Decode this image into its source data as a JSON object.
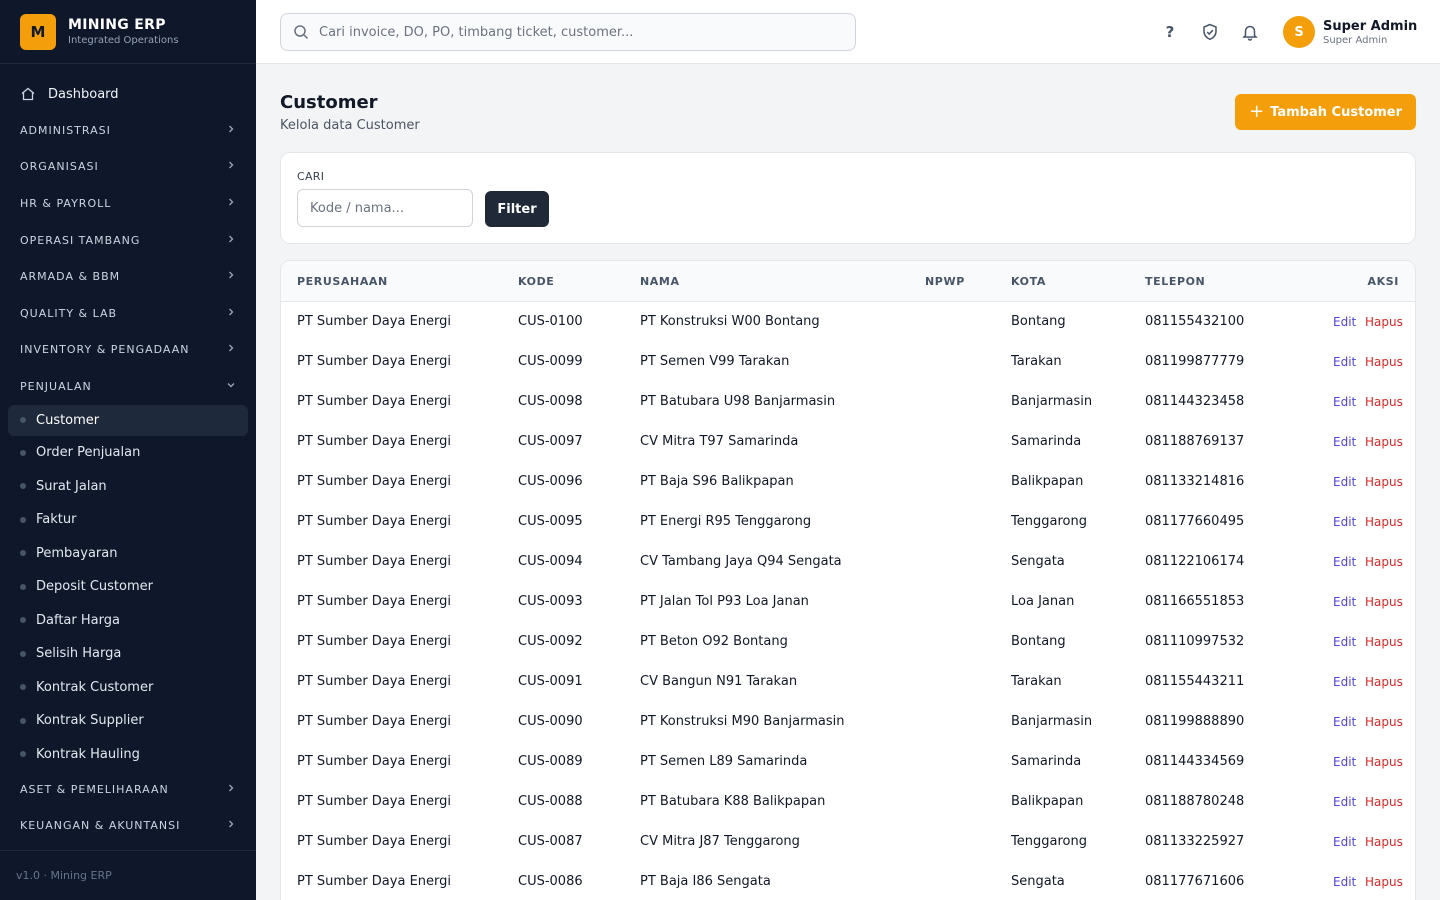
{
  "brand": {
    "logo_letter": "M",
    "name": "MINING ERP",
    "subtitle": "Integrated Operations"
  },
  "sidebar": {
    "dashboard": "Dashboard",
    "sections_top": [
      "ADMINISTRASI",
      "ORGANISASI",
      "HR & PAYROLL",
      "OPERASI TAMBANG",
      "ARMADA & BBM",
      "QUALITY & LAB",
      "INVENTORY & PENGADAAN"
    ],
    "open_section": "PENJUALAN",
    "items": [
      "Customer",
      "Order Penjualan",
      "Surat Jalan",
      "Faktur",
      "Pembayaran",
      "Deposit Customer",
      "Daftar Harga",
      "Selisih Harga",
      "Kontrak Customer",
      "Kontrak Supplier",
      "Kontrak Hauling"
    ],
    "active_item": "Customer",
    "sections_bottom": [
      "ASET & PEMELIHARAAN",
      "KEUANGAN & AKUNTANSI"
    ],
    "footer": "v1.0 · Mining ERP"
  },
  "topbar": {
    "search_placeholder": "Cari invoice, DO, PO, timbang ticket, customer...",
    "help_glyph": "?",
    "user_initial": "S",
    "user_name": "Super Admin",
    "user_role": "Super Admin"
  },
  "page": {
    "title": "Customer",
    "subtitle": "Kelola data Customer",
    "add_button": "Tambah Customer",
    "filter_label": "CARI",
    "filter_placeholder": "Kode / nama...",
    "filter_button": "Filter"
  },
  "table": {
    "headers": [
      "PERUSAHAAN",
      "KODE",
      "NAMA",
      "NPWP",
      "KOTA",
      "TELEPON",
      "AKSI"
    ],
    "edit_label": "Edit",
    "delete_label": "Hapus",
    "rows": [
      {
        "perusahaan": "PT Sumber Daya Energi",
        "kode": "CUS-0100",
        "nama": "PT Konstruksi W00 Bontang",
        "npwp": "",
        "kota": "Bontang",
        "telepon": "081155432100"
      },
      {
        "perusahaan": "PT Sumber Daya Energi",
        "kode": "CUS-0099",
        "nama": "PT Semen V99 Tarakan",
        "npwp": "",
        "kota": "Tarakan",
        "telepon": "081199877779"
      },
      {
        "perusahaan": "PT Sumber Daya Energi",
        "kode": "CUS-0098",
        "nama": "PT Batubara U98 Banjarmasin",
        "npwp": "",
        "kota": "Banjarmasin",
        "telepon": "081144323458"
      },
      {
        "perusahaan": "PT Sumber Daya Energi",
        "kode": "CUS-0097",
        "nama": "CV Mitra T97 Samarinda",
        "npwp": "",
        "kota": "Samarinda",
        "telepon": "081188769137"
      },
      {
        "perusahaan": "PT Sumber Daya Energi",
        "kode": "CUS-0096",
        "nama": "PT Baja S96 Balikpapan",
        "npwp": "",
        "kota": "Balikpapan",
        "telepon": "081133214816"
      },
      {
        "perusahaan": "PT Sumber Daya Energi",
        "kode": "CUS-0095",
        "nama": "PT Energi R95 Tenggarong",
        "npwp": "",
        "kota": "Tenggarong",
        "telepon": "081177660495"
      },
      {
        "perusahaan": "PT Sumber Daya Energi",
        "kode": "CUS-0094",
        "nama": "CV Tambang Jaya Q94 Sengata",
        "npwp": "",
        "kota": "Sengata",
        "telepon": "081122106174"
      },
      {
        "perusahaan": "PT Sumber Daya Energi",
        "kode": "CUS-0093",
        "nama": "PT Jalan Tol P93 Loa Janan",
        "npwp": "",
        "kota": "Loa Janan",
        "telepon": "081166551853"
      },
      {
        "perusahaan": "PT Sumber Daya Energi",
        "kode": "CUS-0092",
        "nama": "PT Beton O92 Bontang",
        "npwp": "",
        "kota": "Bontang",
        "telepon": "081110997532"
      },
      {
        "perusahaan": "PT Sumber Daya Energi",
        "kode": "CUS-0091",
        "nama": "CV Bangun N91 Tarakan",
        "npwp": "",
        "kota": "Tarakan",
        "telepon": "081155443211"
      },
      {
        "perusahaan": "PT Sumber Daya Energi",
        "kode": "CUS-0090",
        "nama": "PT Konstruksi M90 Banjarmasin",
        "npwp": "",
        "kota": "Banjarmasin",
        "telepon": "081199888890"
      },
      {
        "perusahaan": "PT Sumber Daya Energi",
        "kode": "CUS-0089",
        "nama": "PT Semen L89 Samarinda",
        "npwp": "",
        "kota": "Samarinda",
        "telepon": "081144334569"
      },
      {
        "perusahaan": "PT Sumber Daya Energi",
        "kode": "CUS-0088",
        "nama": "PT Batubara K88 Balikpapan",
        "npwp": "",
        "kota": "Balikpapan",
        "telepon": "081188780248"
      },
      {
        "perusahaan": "PT Sumber Daya Energi",
        "kode": "CUS-0087",
        "nama": "CV Mitra J87 Tenggarong",
        "npwp": "",
        "kota": "Tenggarong",
        "telepon": "081133225927"
      },
      {
        "perusahaan": "PT Sumber Daya Energi",
        "kode": "CUS-0086",
        "nama": "PT Baja I86 Sengata",
        "npwp": "",
        "kota": "Sengata",
        "telepon": "081177671606"
      }
    ]
  },
  "colors": {
    "sidebar_bg": "#0f172a",
    "accent": "#f59e0b",
    "edit": "#4f46e5",
    "delete": "#dc2626",
    "dark_button": "#1f2937"
  },
  "icons": {
    "dashboard": "home-icon",
    "search": "search-icon",
    "help": "help-icon",
    "shield": "shield-check-icon",
    "bell": "bell-icon",
    "plus": "plus-icon",
    "chevron": "chevron-right-icon"
  }
}
